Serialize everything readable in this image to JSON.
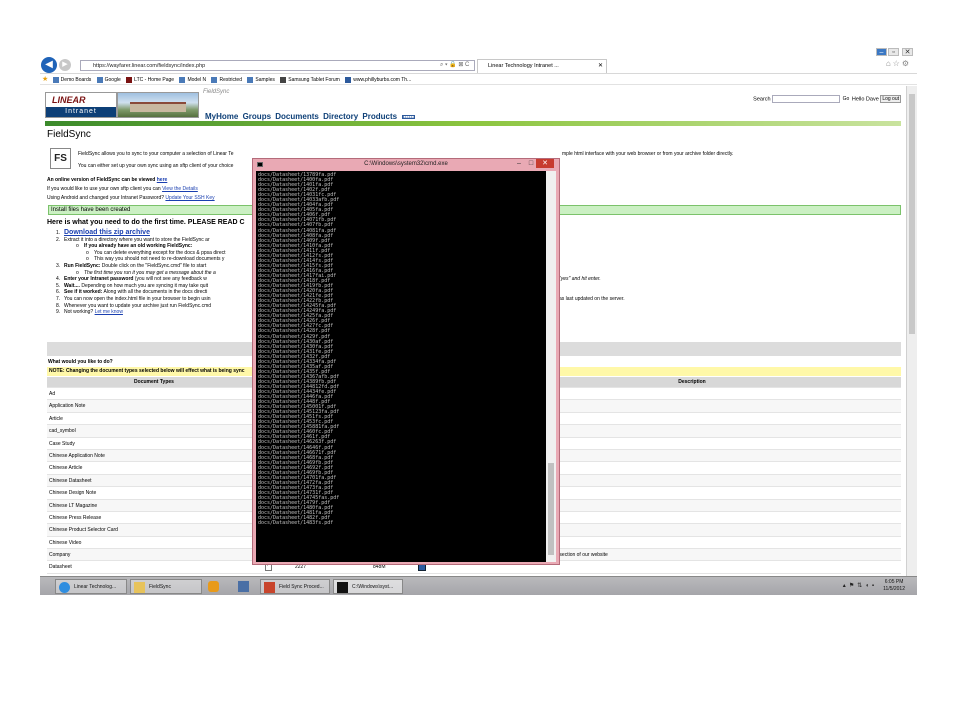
{
  "browser": {
    "url": "https://wayfarer.linear.com/fieldsync/index.php",
    "tab_title": "Linear Technology Intranet ...",
    "favorites": [
      "Demo Boards",
      "Google",
      "LTC - Home Page",
      "Model N",
      "Restricted",
      "Samples",
      "Samsung Tablet Forum",
      "www.phillyburbs.com Th..."
    ]
  },
  "site": {
    "logo_top": "LINEAR",
    "logo_bottom": "Intranet",
    "section_label": "FieldSync",
    "nav": [
      "MyHome",
      "Groups",
      "Documents",
      "Directory",
      "Products"
    ],
    "search_label": "Search",
    "go_label": "Go",
    "greeting": "Hello Dave",
    "logout_label": "Log out"
  },
  "content": {
    "title": "FieldSync",
    "fs_logo": "FS",
    "intro_1": "FieldSync allows you to sync to your computer a selection of Linear Te",
    "intro_1_right": "mple html interface with your web browser or from your archive folder directly.",
    "intro_2": "You can either set up your own sync using an sftp client of your choice",
    "online_prefix": "An online version of FieldSync can be viewed ",
    "online_link": "here",
    "own_prefix": "If you would like to use your own sftp client you can ",
    "own_link": "View the Details",
    "android_prefix": "Using Android and changed your Intranet Password? ",
    "android_link": "Update Your SSH Key",
    "install_banner": "Install files have been created",
    "first_time": "Here is what you need to do the first time. PLEASE READ C",
    "steps": [
      {
        "n": "1.",
        "link": "Download this zip archive"
      },
      {
        "n": "2.",
        "text": "Extract it into a directory where you want to store the FieldSync ar"
      },
      {
        "sub": "o",
        "text": "If you already have an old working FieldSync:"
      },
      {
        "sub": "o",
        "text": "You can delete everything except for the docs & ppsa direct"
      },
      {
        "sub": "o",
        "text": "This way you should not need to re-download documents y"
      },
      {
        "n": "3.",
        "bold": "Run FieldSync:",
        "text": " Double click on the \"FieldSync.cmd\" file to start"
      },
      {
        "sub": "o",
        "text": "The first time you run it you may get a message about the a"
      },
      {
        "n": "4.",
        "bold": "Enter your Intranet password",
        "text": " (you will not see any feedback w"
      },
      {
        "n": "5.",
        "bold": "Wait....",
        "text": " Depending on how much you are syncing it may take quit"
      },
      {
        "n": "6.",
        "bold": "See if it worked:",
        "text": " Along with all the documents in the docs directi"
      },
      {
        "n": "7.",
        "text": "You can now open the index.html file in your browser to begin usin"
      },
      {
        "n": "8.",
        "text": "Whenever you want to update your archive just run FieldSync.cmd"
      },
      {
        "n": "9.",
        "text": "Not working? ",
        "link": "Let me know"
      }
    ],
    "step_right_1": "\"yes\" and hit enter.",
    "step_right_2": "as last updated on the server.",
    "what_todo": "What would you like to do?",
    "note": "NOTE: Changing the document types selected below will effect what is being sync",
    "table_headers": {
      "doc_types": "Document Types",
      "description": "Description"
    },
    "rows": [
      {
        "type": "Ad",
        "checked": false,
        "count": "",
        "size": "",
        "desc": ""
      },
      {
        "type": "Application Note",
        "checked": false,
        "count": "",
        "size": "",
        "desc": ""
      },
      {
        "type": "Article",
        "checked": false,
        "count": "",
        "size": "",
        "desc": "ched to product or category pages"
      },
      {
        "type": "cad_symbol",
        "checked": false,
        "count": "",
        "size": "",
        "desc": ""
      },
      {
        "type": "Case Study",
        "checked": false,
        "count": "",
        "size": "",
        "desc": ""
      },
      {
        "type": "Chinese Application Note",
        "checked": false,
        "count": "",
        "size": "",
        "desc": ""
      },
      {
        "type": "Chinese Article",
        "checked": false,
        "count": "",
        "size": "",
        "desc": ""
      },
      {
        "type": "Chinese Datasheet",
        "checked": false,
        "count": "",
        "size": "",
        "desc": ""
      },
      {
        "type": "Chinese Design Note",
        "checked": false,
        "count": "",
        "size": "",
        "desc": ""
      },
      {
        "type": "Chinese LT Magazine",
        "checked": false,
        "count": "",
        "size": "",
        "desc": ""
      },
      {
        "type": "Chinese Press Release",
        "checked": false,
        "count": "",
        "size": "",
        "desc": ""
      },
      {
        "type": "Chinese Product Selector Card",
        "checked": false,
        "count": "1",
        "size": "328K",
        "desc": ""
      },
      {
        "type": "Chinese Video",
        "checked": false,
        "count": "51",
        "size": "1.2G",
        "desc": ""
      },
      {
        "type": "Company",
        "checked": false,
        "count": "17",
        "size": "3.9M",
        "desc": "Docs you will find in the Company section of our website"
      },
      {
        "type": "Datasheet",
        "checked": true,
        "count": "2227",
        "size": "848M",
        "desc": ""
      }
    ]
  },
  "cmd": {
    "title": "C:\\Windows\\system32\\cmd.exe",
    "lines": [
      "docs/Datasheet/13789fa.pdf",
      "docs/Datasheet/1400fa.pdf",
      "docs/Datasheet/1401fa.pdf",
      "docs/Datasheet/1402f.pdf",
      "docs/Datasheet/14031fc.pdf",
      "docs/Datasheet/14033afb.pdf",
      "docs/Datasheet/1404fa.pdf",
      "docs/Datasheet/1405fa.pdf",
      "docs/Datasheet/1406f.pdf",
      "docs/Datasheet/14071fb.pdf",
      "docs/Datasheet/1407fb.pdf",
      "docs/Datasheet/14081fa.pdf",
      "docs/Datasheet/1408fa.pdf",
      "docs/Datasheet/1409f.pdf",
      "docs/Datasheet/1410fa.pdf",
      "docs/Datasheet/1411f.pdf",
      "docs/Datasheet/1412fs.pdf",
      "docs/Datasheet/1414fs.pdf",
      "docs/Datasheet/1415fs.pdf",
      "docs/Datasheet/1416fa.pdf",
      "docs/Datasheet/1417fai.pdf",
      "docs/Datasheet/1418f.pdf",
      "docs/Datasheet/1419fb.pdf",
      "docs/Datasheet/1420fa.pdf",
      "docs/Datasheet/1421fe.pdf",
      "docs/Datasheet/1422fb.pdf",
      "docs/Datasheet/14245fa.pdf",
      "docs/Datasheet/14249fa.pdf",
      "docs/Datasheet/1425fa.pdf",
      "docs/Datasheet/1426f.pdf",
      "docs/Datasheet/1427fc.pdf",
      "docs/Datasheet/1428f.pdf",
      "docs/Datasheet/1429f.pdf",
      "docs/Datasheet/1430af.pdf",
      "docs/Datasheet/1430fa.pdf",
      "docs/Datasheet/1431fe.pdf",
      "docs/Datasheet/1432f.pdf",
      "docs/Datasheet/14334fa.pdf",
      "docs/Datasheet/1435af.pdf",
      "docs/Datasheet/1435f.pdf",
      "docs/Datasheet/14367afb.pdf",
      "docs/Datasheet/14389fb.pdf",
      "docs/Datasheet/144812fd.pdf",
      "docs/Datasheet/14434fe.pdf",
      "docs/Datasheet/1446fa.pdf",
      "docs/Datasheet/1448f.pdf",
      "docs/Datasheet/145001f.pdf",
      "docs/Datasheet/145123fa.pdf",
      "docs/Datasheet/1451fs.pdf",
      "docs/Datasheet/1453fc.pdf",
      "docs/Datasheet/145881fa.pdf",
      "docs/Datasheet/1460fc.pdf",
      "docs/Datasheet/1461f.pdf",
      "docs/Datasheet/146263f.pdf",
      "docs/Datasheet/14646f.pdf",
      "docs/Datasheet/146671f.pdf",
      "docs/Datasheet/1468fa.pdf",
      "docs/Datasheet/1469fb.pdf",
      "docs/Datasheet/14692f.pdf",
      "docs/Datasheet/1469fb.pdf",
      "docs/Datasheet/14701fa.pdf",
      "docs/Datasheet/1472fa.pdf",
      "docs/Datasheet/1473fa.pdf",
      "docs/Datasheet/14731f.pdf",
      "docs/Datasheet/14745fas.pdf",
      "docs/Datasheet/1479f.pdf",
      "docs/Datasheet/1480fa.pdf",
      "docs/Datasheet/1481fa.pdf",
      "docs/Datasheet/1482f.pdf",
      "docs/Datasheet/1483fs.pdf"
    ]
  },
  "taskbar": {
    "items": [
      "Linear Technolog...",
      "FieldSync",
      "",
      "",
      "Field Sync Proced...",
      "C:\\Windows\\syst..."
    ],
    "time": "6:05 PM",
    "date": "11/5/2012"
  }
}
